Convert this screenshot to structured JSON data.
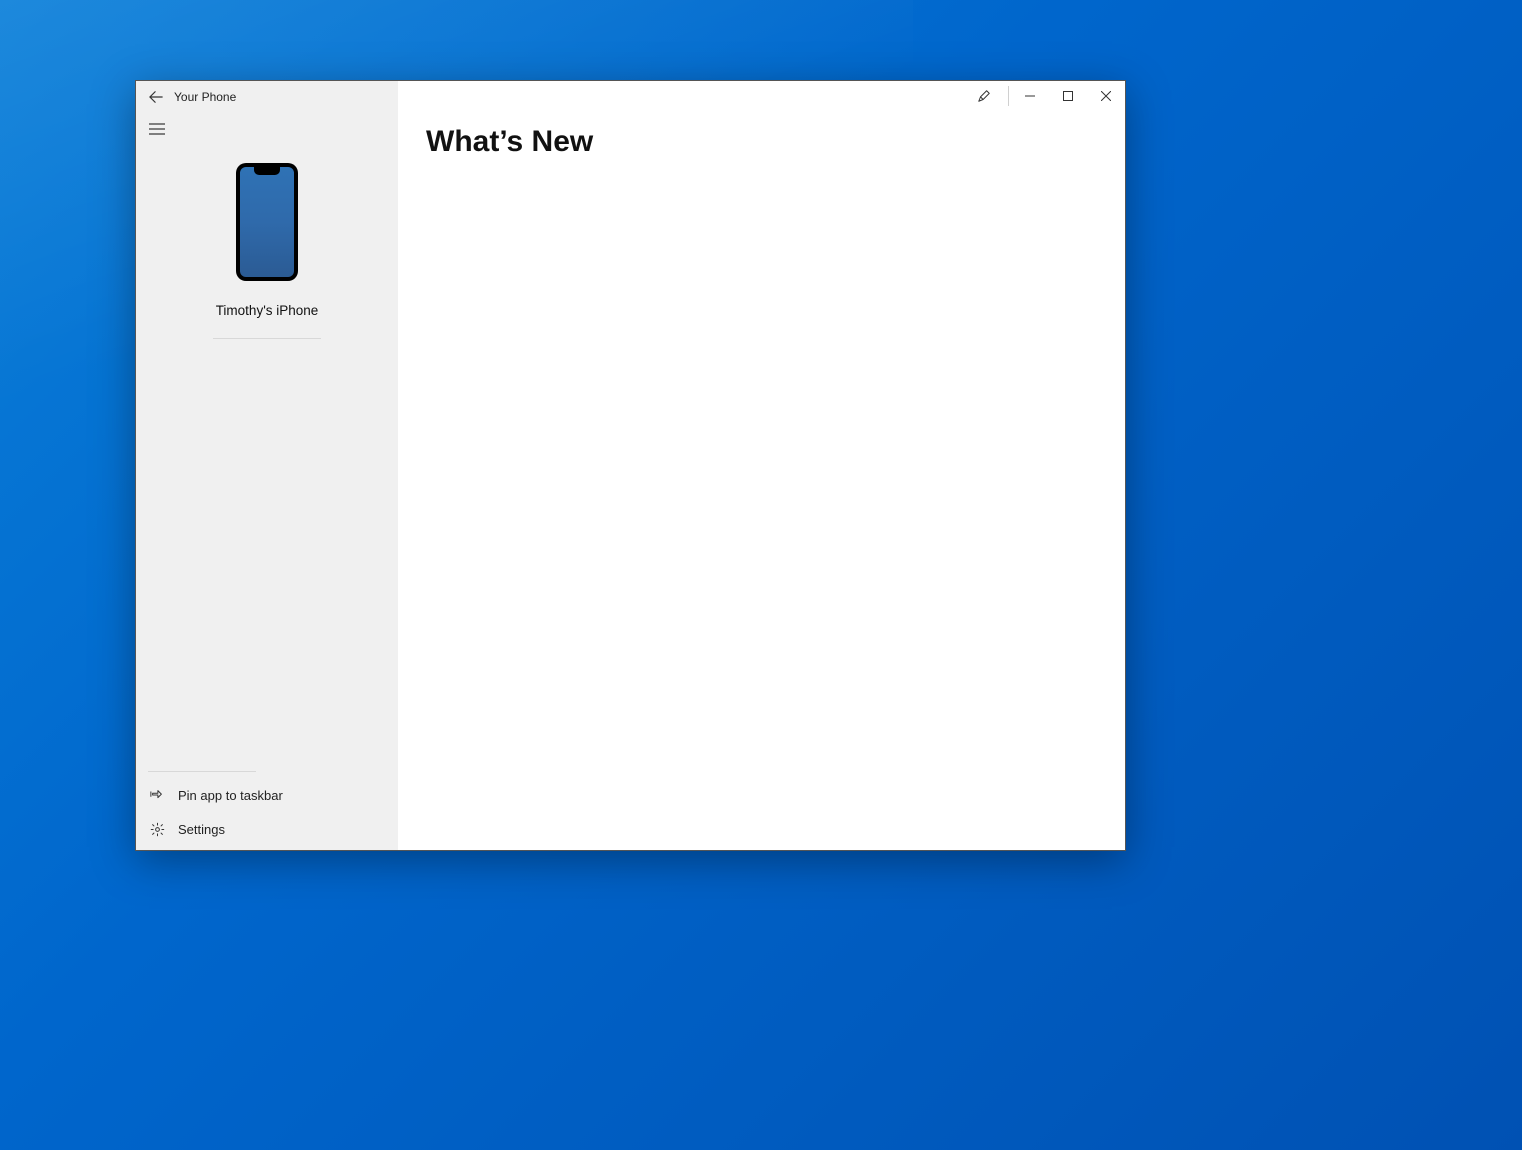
{
  "app": {
    "title": "Your Phone"
  },
  "sidebar": {
    "device_name": "Timothy's iPhone",
    "pin_label": "Pin app to taskbar",
    "settings_label": "Settings"
  },
  "main": {
    "heading": "What’s New"
  }
}
